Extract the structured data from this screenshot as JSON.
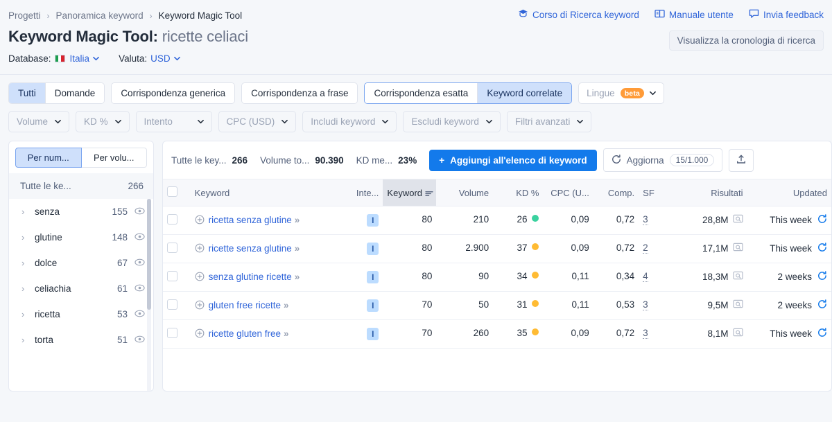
{
  "breadcrumb": {
    "items": [
      {
        "label": "Progetti"
      },
      {
        "label": "Panoramica keyword"
      },
      {
        "label": "Keyword Magic Tool"
      }
    ],
    "separator": "›"
  },
  "header": {
    "title": "Keyword Magic Tool:",
    "query": "ricette celiaci",
    "database_label": "Database:",
    "database_value": "Italia",
    "currency_label": "Valuta:",
    "currency_value": "USD",
    "links": [
      {
        "label": "Corso di Ricerca keyword",
        "icon": "graduation-cap-icon"
      },
      {
        "label": "Manuale utente",
        "icon": "book-icon"
      },
      {
        "label": "Invia feedback",
        "icon": "speech-bubble-icon"
      }
    ],
    "history_button": "Visualizza la cronologia di ricerca"
  },
  "filters": {
    "match_tabs_group1": [
      {
        "label": "Tutti",
        "selected": true
      },
      {
        "label": "Domande",
        "selected": false
      }
    ],
    "match_tabs_group2": [
      {
        "label": "Corrispondenza generica",
        "selected": false
      },
      {
        "label": "Corrispondenza a frase",
        "selected": false
      },
      {
        "label": "Corrispondenza esatta",
        "selected": false
      },
      {
        "label": "Keyword correlate",
        "selected": true
      }
    ],
    "lingue": {
      "label": "Lingue",
      "badge": "beta"
    },
    "dropdowns": [
      {
        "label": "Volume"
      },
      {
        "label": "KD %"
      },
      {
        "label": "Intento"
      },
      {
        "label": "CPC (USD)"
      },
      {
        "label": "Includi keyword"
      },
      {
        "label": "Escludi keyword"
      },
      {
        "label": "Filtri avanzati"
      }
    ]
  },
  "sidebar": {
    "toggle": [
      {
        "label": "Per num...",
        "selected": true
      },
      {
        "label": "Per volu...",
        "selected": false
      }
    ],
    "all_label": "Tutte le ke...",
    "all_count": "266",
    "items": [
      {
        "label": "senza",
        "count": "155"
      },
      {
        "label": "glutine",
        "count": "148"
      },
      {
        "label": "dolce",
        "count": "67"
      },
      {
        "label": "celiachia",
        "count": "61"
      },
      {
        "label": "ricetta",
        "count": "53"
      },
      {
        "label": "torta",
        "count": "51"
      }
    ]
  },
  "toolbar": {
    "stats": [
      {
        "label": "Tutte le key...",
        "value": "266"
      },
      {
        "label": "Volume to...",
        "value": "90.390"
      },
      {
        "label": "KD me...",
        "value": "23%"
      }
    ],
    "add_button": "Aggiungi all'elenco di keyword",
    "refresh_button": "Aggiorna",
    "refresh_quota": "15/1.000",
    "export_icon": "export-icon"
  },
  "table": {
    "columns": [
      {
        "key": "checkbox",
        "label": "",
        "align": "left"
      },
      {
        "key": "keyword",
        "label": "Keyword",
        "align": "left"
      },
      {
        "key": "intent",
        "label": "Inte...",
        "align": "right"
      },
      {
        "key": "kwgroup",
        "label": "Keyword",
        "align": "right",
        "sorted": true
      },
      {
        "key": "volume",
        "label": "Volume",
        "align": "right"
      },
      {
        "key": "kd",
        "label": "KD %",
        "align": "right"
      },
      {
        "key": "cpc",
        "label": "CPC (U...",
        "align": "right"
      },
      {
        "key": "comp",
        "label": "Comp.",
        "align": "right"
      },
      {
        "key": "sf",
        "label": "SF",
        "align": "left"
      },
      {
        "key": "results",
        "label": "Risultati",
        "align": "right"
      },
      {
        "key": "updated",
        "label": "Updated",
        "align": "right"
      }
    ],
    "rows": [
      {
        "keyword": "ricetta senza glutine",
        "intent": "I",
        "kwgroup": "80",
        "volume": "210",
        "kd": "26",
        "kd_color": "#3ad29f",
        "cpc": "0,09",
        "comp": "0,72",
        "sf": "3",
        "results": "28,8M",
        "updated": "This week"
      },
      {
        "keyword": "ricette senza glutine",
        "intent": "I",
        "kwgroup": "80",
        "volume": "2.900",
        "kd": "37",
        "kd_color": "#ffbb33",
        "cpc": "0,09",
        "comp": "0,72",
        "sf": "2",
        "results": "17,1M",
        "updated": "This week"
      },
      {
        "keyword": "senza glutine ricette",
        "intent": "I",
        "kwgroup": "80",
        "volume": "90",
        "kd": "34",
        "kd_color": "#ffbb33",
        "cpc": "0,11",
        "comp": "0,34",
        "sf": "4",
        "results": "18,3M",
        "updated": "2 weeks"
      },
      {
        "keyword": "gluten free ricette",
        "intent": "I",
        "kwgroup": "70",
        "volume": "50",
        "kd": "31",
        "kd_color": "#ffbb33",
        "cpc": "0,11",
        "comp": "0,53",
        "sf": "3",
        "results": "9,5M",
        "updated": "2 weeks"
      },
      {
        "keyword": "ricette gluten free",
        "intent": "I",
        "kwgroup": "70",
        "volume": "260",
        "kd": "35",
        "kd_color": "#ffbb33",
        "cpc": "0,09",
        "comp": "0,72",
        "sf": "3",
        "results": "8,1M",
        "updated": "This week"
      }
    ]
  },
  "colors": {
    "accent": "#137aeb",
    "link": "#2f64d9",
    "selected_tab_bg": "#cfe0fb",
    "beta_badge": "#ff9b38"
  }
}
